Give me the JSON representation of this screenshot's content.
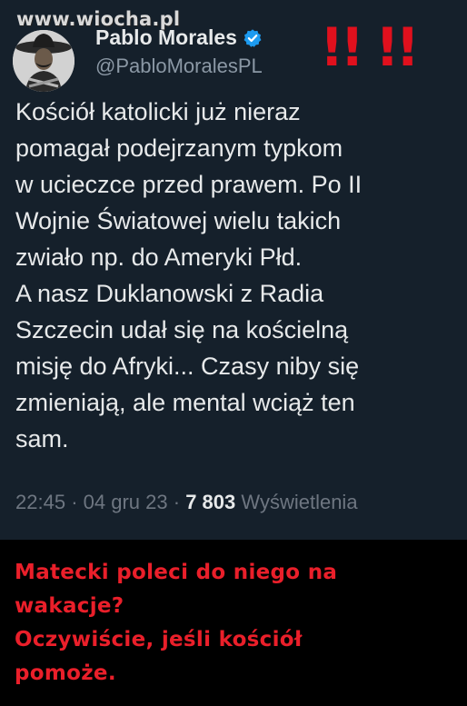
{
  "watermark": "www.wiocha.pl",
  "author": {
    "display_name": "Pablo Morales",
    "handle": "@PabloMoralesPL"
  },
  "alarm_marks": "!! !!",
  "tweet": {
    "lines": [
      "Kościół katolicki już nieraz",
      "pomagał podejrzanym typkom",
      "w ucieczce przed prawem. Po II",
      "Wojnie Światowej wielu takich",
      "zwiało np. do Ameryki Płd.",
      "A nasz Duklanowski z Radia",
      "Szczecin udał się na kościelną",
      "misję do Afryki... Czasy niby się",
      "zmieniają, ale mental wciąż ten",
      "sam."
    ],
    "time": "22:45",
    "separator": "·",
    "date": "04 gru 23",
    "views_count": "7 803",
    "views_label": "Wyświetlenia"
  },
  "comment": {
    "lines": [
      "Matecki poleci do niego na",
      "wakacje?",
      "Oczywiście, jeśli kościół",
      "pomoże."
    ]
  },
  "colors": {
    "tweet_background": "#15202b",
    "page_background": "#000000",
    "text": "#e7e9ea",
    "secondary_text": "#8b98a5",
    "verified_blue": "#1d9bf0",
    "alarm_red": "#e0101d",
    "comment_red": "#ea1f2a"
  },
  "icons": {
    "verified": "verified-badge-icon"
  }
}
